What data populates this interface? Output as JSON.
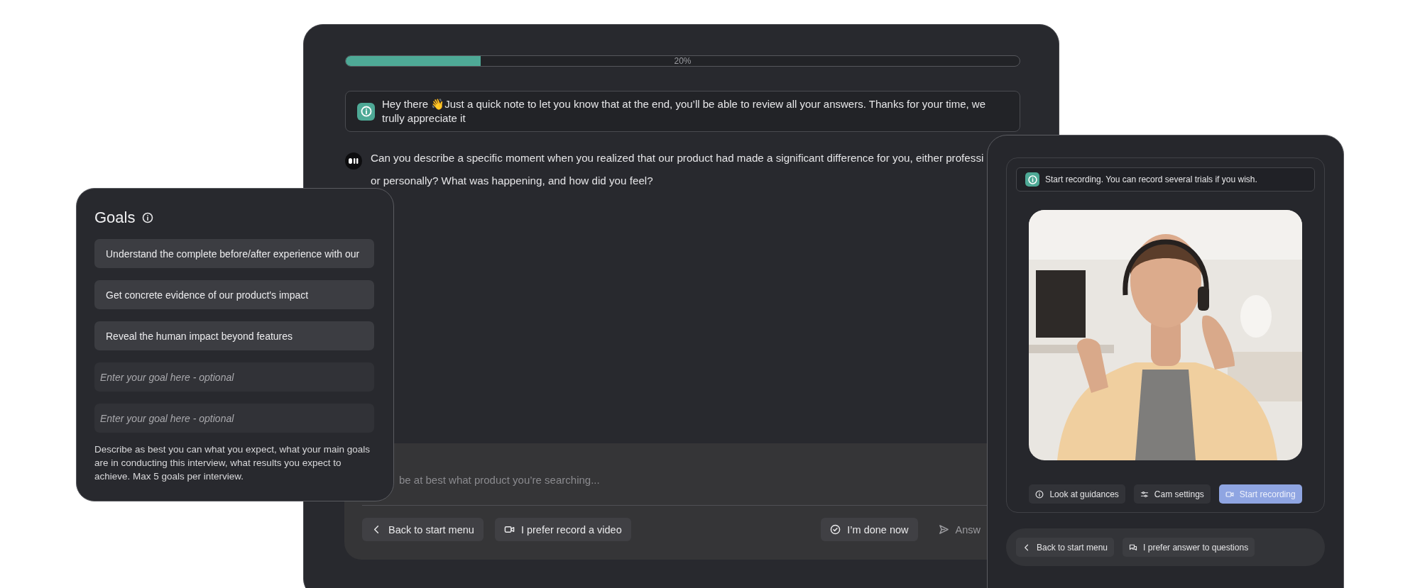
{
  "progress": {
    "level": 0.2,
    "label": "20%"
  },
  "notice": {
    "text": "Hey there 👋Just a quick note to let you know that at the end, you’ll be able to review all your answers. Thanks for your time, we trully appreciate it"
  },
  "question": {
    "lines": [
      "Can you describe a specific moment when you realized that our product had made a significant difference for you, either professi",
      "or personally? What was happening, and how did you feel?"
    ]
  },
  "composer": {
    "placeholder": "be at best what product you’re searching...",
    "buttons": [
      {
        "kind": "back",
        "label": "Back to start menu"
      },
      {
        "kind": "video",
        "label": "I prefer record a video"
      },
      {
        "kind": "done",
        "label": "I’m done now"
      },
      {
        "kind": "send",
        "label": "Answ"
      }
    ]
  },
  "goals_panel": {
    "title": "Goals",
    "goals": [
      {
        "value": "Understand the complete before/after experience with our"
      },
      {
        "value": "Get concrete evidence of our product's impact"
      },
      {
        "value": "Reveal the human impact beyond features"
      },
      {
        "placeholder": "Enter your goal here - optional"
      },
      {
        "placeholder": "Enter your goal here - optional"
      }
    ],
    "description": "Describe as best you can what you expect, what your main goals are in conducting this interview, what results you expect to achieve. Max 5 goals per interview."
  },
  "recorder": {
    "notice": "Start recording. You can record several trials if you wish.",
    "actions": [
      {
        "kind": "info",
        "label": "Look at guidances",
        "primary": false
      },
      {
        "kind": "settings",
        "label": "Cam settings",
        "primary": false
      },
      {
        "kind": "video",
        "label": "Start recording",
        "primary": true
      }
    ],
    "footer": [
      {
        "kind": "back",
        "label": "Back to start menu"
      },
      {
        "kind": "chat",
        "label": "I prefer answer to questions"
      }
    ]
  }
}
